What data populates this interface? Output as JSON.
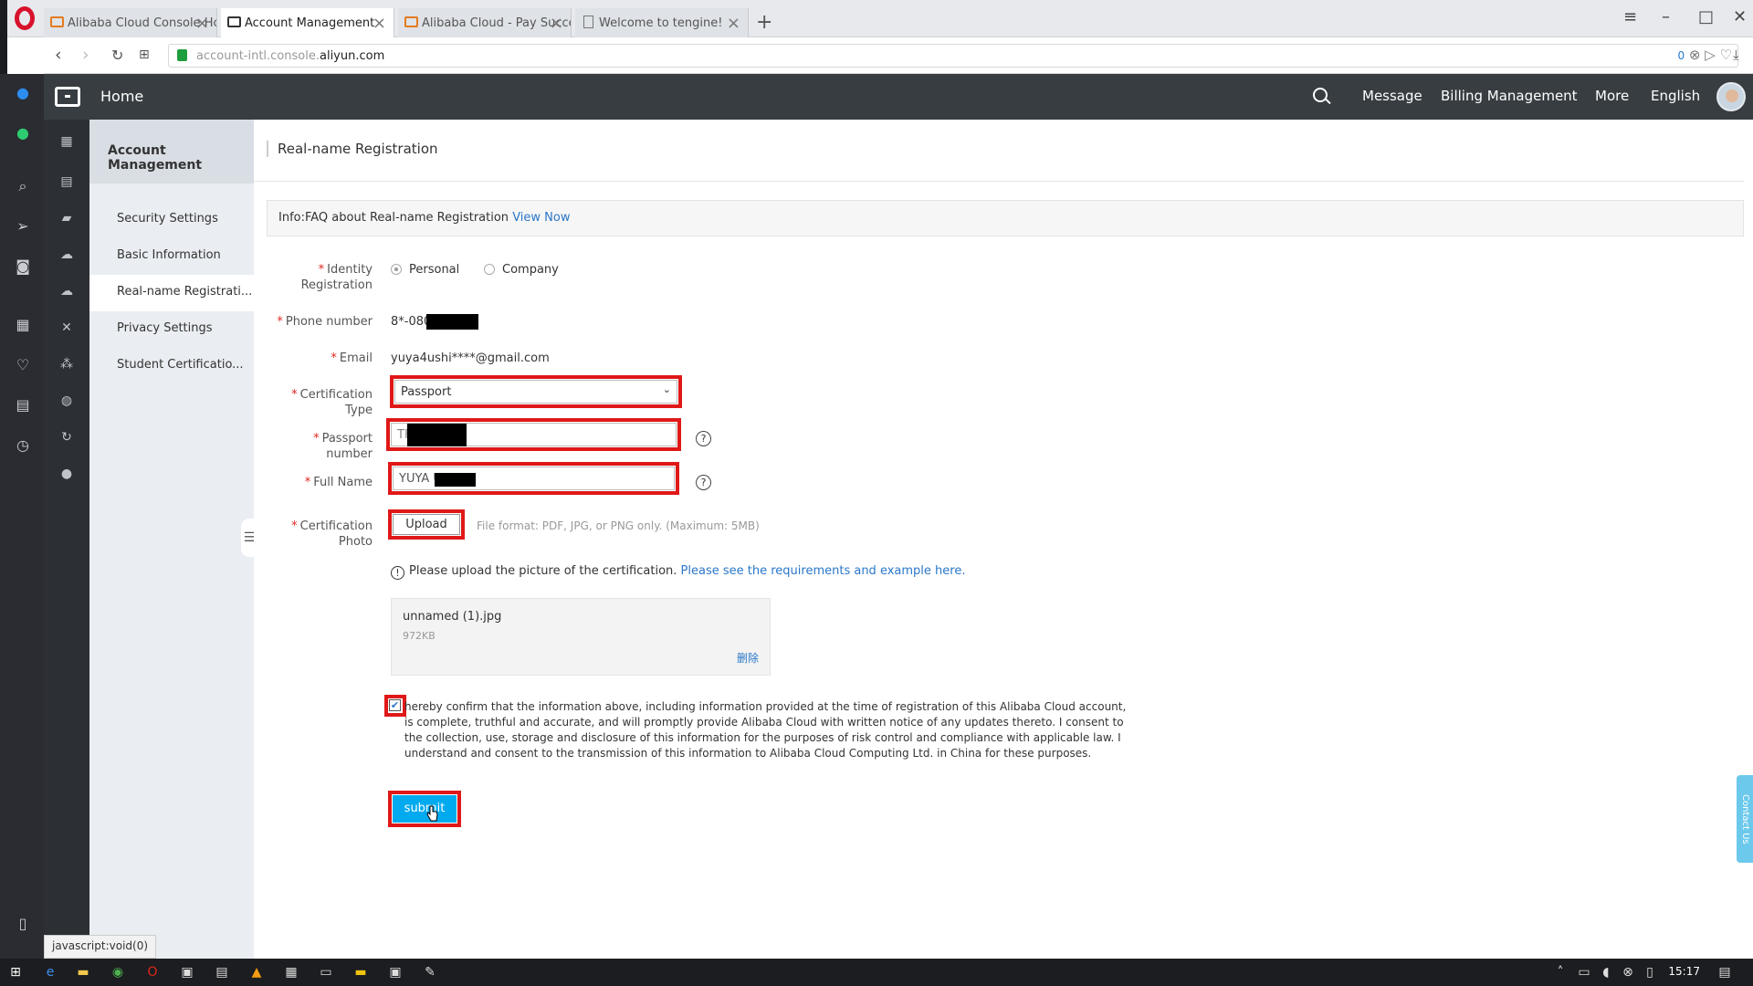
{
  "browser": {
    "tabs": [
      {
        "label": "Alibaba Cloud Console Ho",
        "active": false
      },
      {
        "label": "Account Management",
        "active": true
      },
      {
        "label": "Alibaba Cloud - Pay Succe",
        "active": false
      },
      {
        "label": "Welcome to tengine!",
        "active": false
      }
    ],
    "url_prefix": "account-intl.console.",
    "url_domain": "aliyun.com",
    "url_badge": "0",
    "new_tab": "+",
    "status_text": "javascript:void(0)"
  },
  "topnav": {
    "home": "Home",
    "items": [
      "Message",
      "Billing Management",
      "More",
      "English"
    ]
  },
  "submenu": {
    "title": "Account Management",
    "items": [
      {
        "label": "Security Settings",
        "active": false
      },
      {
        "label": "Basic Information",
        "active": false
      },
      {
        "label": "Real-name Registrati...",
        "active": true
      },
      {
        "label": "Privacy Settings",
        "active": false
      },
      {
        "label": "Student Certificatio...",
        "active": false
      }
    ]
  },
  "page": {
    "title": "Real-name Registration",
    "info_prefix": "Info:FAQ about Real-name Registration",
    "info_link": "View Now"
  },
  "form": {
    "identity_label": "Identity Registration",
    "identity_options": [
      "Personal",
      "Company"
    ],
    "identity_selected": "Personal",
    "phone_label": "Phone number",
    "phone_value": "8*-080",
    "email_label": "Email",
    "email_value": "yuya4ushi****@gmail.com",
    "cert_type_label": "Certification Type",
    "cert_type_value": "Passport",
    "passport_label": "Passport number",
    "passport_value": "TF",
    "fullname_label": "Full Name",
    "fullname_value": "YUYA US",
    "photo_label": "Certification Photo",
    "upload_label": "Upload",
    "upload_hint": "File format: PDF, JPG, or PNG only. (Maximum: 5MB)",
    "notice_text": "Please upload the picture of the certification.",
    "notice_link": "Please see the requirements and example here.",
    "file_name": "unnamed (1).jpg",
    "file_size": "972KB",
    "file_delete": "删除",
    "confirm_text": "hereby confirm that the information above, including information provided at the time of registration of this Alibaba Cloud account, is complete, truthful and accurate, and will promptly provide Alibaba Cloud with written notice of any updates thereto. I consent to the collection, use, storage and disclosure of this information for the purposes of risk control and compliance with applicable law. I understand and consent to the transmission of this information to Alibaba Cloud Computing Ltd. in China for these purposes.",
    "confirm_checked": true,
    "submit_label": "submit",
    "required_mark": "*",
    "help_mark": "?",
    "notice_mark": "!"
  },
  "contact_tab": "Contact Us",
  "taskbar": {
    "time": "15:17"
  },
  "colors": {
    "accent": "#00aaee",
    "link": "#2a77c9",
    "highlight": "#e01818",
    "topnav": "#373d41"
  }
}
